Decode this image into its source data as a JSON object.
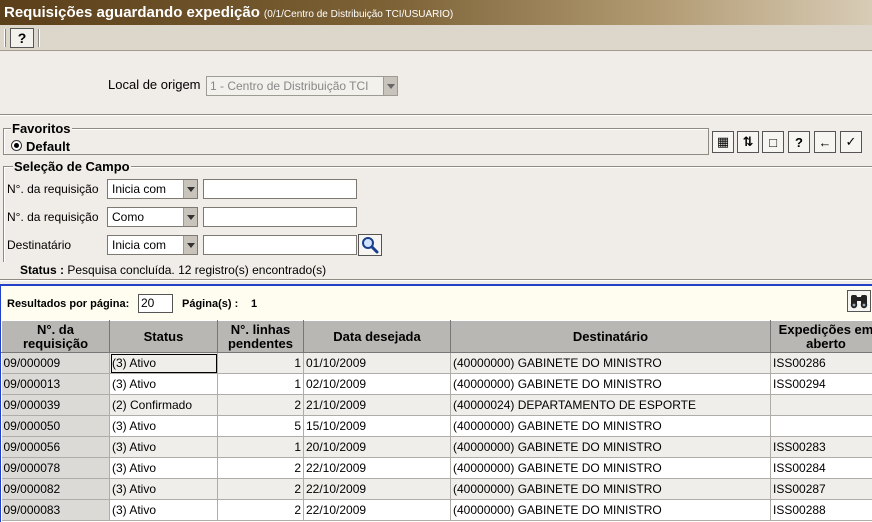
{
  "window": {
    "title": "Requisições aguardando expedição",
    "subtitle": "(0/1/Centro de Distribuição TCI/USUARIO)"
  },
  "toolbar": {
    "help_label": "?"
  },
  "origem": {
    "label": "Local de origem",
    "value": "1 - Centro de Distribuição TCI"
  },
  "favoritos": {
    "legend": "Favoritos",
    "default_label": "Default",
    "buttons": [
      {
        "name": "columns-icon",
        "glyph": "▦"
      },
      {
        "name": "sort-icon",
        "glyph": "⇅"
      },
      {
        "name": "blank-page-icon",
        "glyph": "□"
      },
      {
        "name": "help-icon",
        "glyph": "?"
      },
      {
        "name": "back-arrow-icon",
        "glyph": "←"
      },
      {
        "name": "checkmark-icon",
        "glyph": "✓"
      }
    ]
  },
  "selecao": {
    "legend": "Seleção de Campo",
    "fields": [
      {
        "label": "N°. da requisição",
        "operator": "Inicia com",
        "value": ""
      },
      {
        "label": "N°. da requisição",
        "operator": "Como",
        "value": ""
      },
      {
        "label": "Destinatário",
        "operator": "Inicia com",
        "value": ""
      }
    ]
  },
  "status": {
    "label": "Status :",
    "text": "Pesquisa concluída. 12 registro(s) encontrado(s)"
  },
  "results": {
    "per_page_label": "Resultados por página:",
    "per_page_value": "20",
    "page_label": "Página(s) :",
    "page_value": "1",
    "columns": [
      "N°. da requisição",
      "Status",
      "N°. linhas pendentes",
      "Data desejada",
      "Destinatário",
      "Expedições em aberto"
    ],
    "rows": [
      [
        "09/000009",
        "(3) Ativo",
        "1",
        "01/10/2009",
        "(40000000) GABINETE DO MINISTRO",
        "ISS00286"
      ],
      [
        "09/000013",
        "(3) Ativo",
        "1",
        "02/10/2009",
        "(40000000) GABINETE DO MINISTRO",
        "ISS00294"
      ],
      [
        "09/000039",
        "(2) Confirmado",
        "2",
        "21/10/2009",
        "(40000024) DEPARTAMENTO DE ESPORTE",
        ""
      ],
      [
        "09/000050",
        "(3) Ativo",
        "5",
        "15/10/2009",
        "(40000000) GABINETE DO MINISTRO",
        ""
      ],
      [
        "09/000056",
        "(3) Ativo",
        "1",
        "20/10/2009",
        "(40000000) GABINETE DO MINISTRO",
        "ISS00283"
      ],
      [
        "09/000078",
        "(3) Ativo",
        "2",
        "22/10/2009",
        "(40000000) GABINETE DO MINISTRO",
        "ISS00284"
      ],
      [
        "09/000082",
        "(3) Ativo",
        "2",
        "22/10/2009",
        "(40000000) GABINETE DO MINISTRO",
        "ISS00287"
      ],
      [
        "09/000083",
        "(3) Ativo",
        "2",
        "22/10/2009",
        "(40000000) GABINETE DO MINISTRO",
        "ISS00288"
      ]
    ]
  }
}
